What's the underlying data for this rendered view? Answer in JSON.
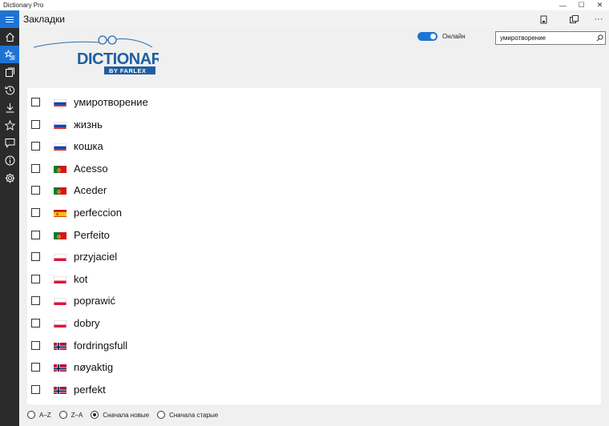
{
  "window": {
    "title": "Dictionary Pro",
    "minimize": "—",
    "maximize": "☐",
    "close": "✕"
  },
  "header": {
    "title": "Закладки",
    "more": "···"
  },
  "nav": [
    "home-icon",
    "bookmarks-icon",
    "cards-icon",
    "history-icon",
    "download-icon",
    "favorites-icon",
    "chat-icon",
    "info-icon",
    "settings-icon"
  ],
  "online_label": "Онлайн",
  "online": true,
  "search": {
    "value": "умиротворение"
  },
  "bookmarks": [
    {
      "word": "умиротворение",
      "flag": "ru"
    },
    {
      "word": "жизнь",
      "flag": "ru"
    },
    {
      "word": "кошка",
      "flag": "ru"
    },
    {
      "word": "Acesso",
      "flag": "pt"
    },
    {
      "word": "Aceder",
      "flag": "pt"
    },
    {
      "word": "perfeccion",
      "flag": "es"
    },
    {
      "word": "Perfeito",
      "flag": "pt"
    },
    {
      "word": "przyjaciel",
      "flag": "pl"
    },
    {
      "word": "kot",
      "flag": "pl"
    },
    {
      "word": "poprawić",
      "flag": "pl"
    },
    {
      "word": "dobry",
      "flag": "pl"
    },
    {
      "word": "fordringsfull",
      "flag": "no"
    },
    {
      "word": "nøyaktig",
      "flag": "no"
    },
    {
      "word": "perfekt",
      "flag": "no"
    }
  ],
  "sort": {
    "options": [
      "A–Z",
      "Z–A",
      "Сначала новые",
      "Сначала старые"
    ],
    "selected": 2
  },
  "colors": {
    "accent": "#1e74d4",
    "nav_bg": "#2b2b2b"
  }
}
